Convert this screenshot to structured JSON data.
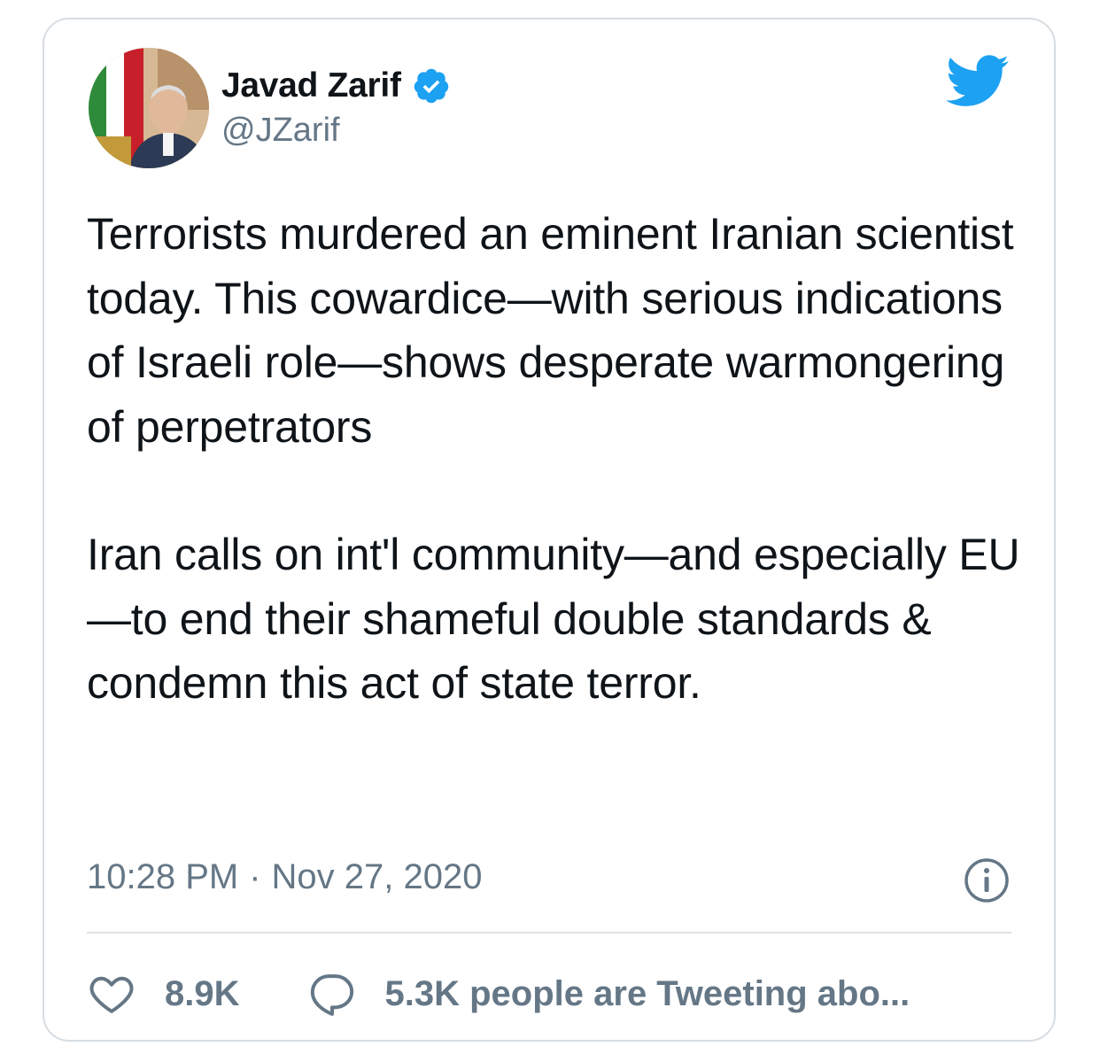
{
  "user": {
    "display_name": "Javad Zarif",
    "handle": "@JZarif",
    "verified": true
  },
  "tweet": {
    "paragraph_1": "Terrorists murdered an eminent Iranian scientist today. This cowardice—with serious indications of Israeli role—shows desperate warmongering of perpetrators",
    "paragraph_2": "Iran calls on int'l community—and especially EU—to end their shameful double standards & condemn this act of state terror."
  },
  "meta": {
    "time": "10:28 PM",
    "separator": "·",
    "date": "Nov 27, 2020"
  },
  "actions": {
    "likes_count": "8.9K",
    "conversation_label": "5.3K people are Tweeting abo..."
  },
  "colors": {
    "twitter_blue": "#1da1f2",
    "text": "#0f1419",
    "secondary": "#657786",
    "border": "#d7dde2"
  },
  "icons": [
    "verified-badge-icon",
    "twitter-bird-icon",
    "info-icon",
    "heart-icon",
    "speech-bubble-icon"
  ]
}
